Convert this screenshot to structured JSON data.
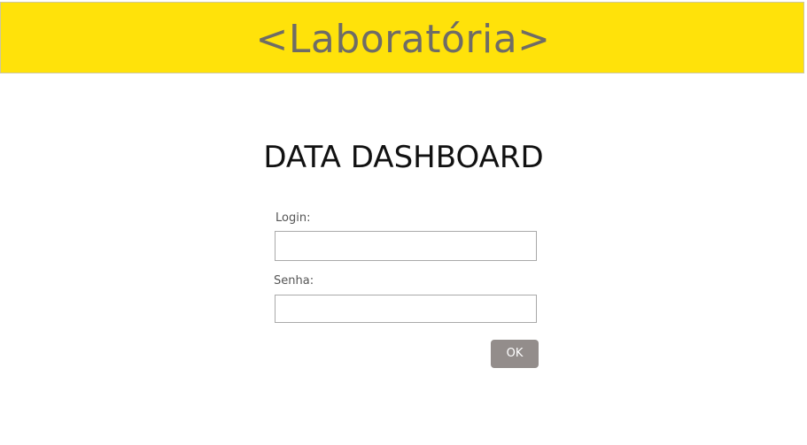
{
  "header": {
    "logo_text": "<Laboratória>"
  },
  "main": {
    "title": "DATA DASHBOARD",
    "login_form": {
      "login_label": "Login:",
      "login_value": "",
      "password_label": "Senha:",
      "password_value": "",
      "submit_label": "OK"
    }
  },
  "colors": {
    "header_background": "#ffe20a",
    "logo_text": "#6f6c66",
    "button_background": "#938d8b",
    "button_text": "#ffffff"
  }
}
